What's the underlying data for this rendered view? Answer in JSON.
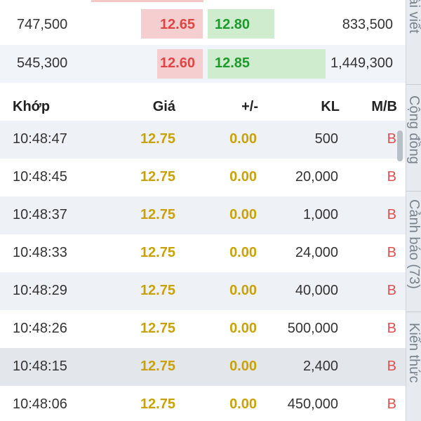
{
  "order_book": [
    {
      "bid_volume": "747,500",
      "bid_price": "12.65",
      "ask_price": "12.80",
      "ask_volume": "833,500"
    },
    {
      "bid_volume": "545,300",
      "bid_price": "12.60",
      "ask_price": "12.85",
      "ask_volume": "1,449,300"
    }
  ],
  "trades": {
    "headers": {
      "time": "Khớp",
      "price": "Giá",
      "change": "+/-",
      "volume": "KL",
      "side": "M/B"
    },
    "rows": [
      {
        "time": "10:48:47",
        "price": "12.75",
        "change": "0.00",
        "volume": "500",
        "side": "B"
      },
      {
        "time": "10:48:45",
        "price": "12.75",
        "change": "0.00",
        "volume": "20,000",
        "side": "B"
      },
      {
        "time": "10:48:37",
        "price": "12.75",
        "change": "0.00",
        "volume": "1,000",
        "side": "B"
      },
      {
        "time": "10:48:33",
        "price": "12.75",
        "change": "0.00",
        "volume": "24,000",
        "side": "B"
      },
      {
        "time": "10:48:29",
        "price": "12.75",
        "change": "0.00",
        "volume": "40,000",
        "side": "B"
      },
      {
        "time": "10:48:26",
        "price": "12.75",
        "change": "0.00",
        "volume": "500,000",
        "side": "B"
      },
      {
        "time": "10:48:15",
        "price": "12.75",
        "change": "0.00",
        "volume": "2,400",
        "side": "B"
      },
      {
        "time": "10:48:06",
        "price": "12.75",
        "change": "0.00",
        "volume": "450,000",
        "side": "B"
      }
    ]
  },
  "side_tabs": [
    {
      "label": "Bài viết"
    },
    {
      "label": "Cộng đồng"
    },
    {
      "label": "Cảnh báo (73)"
    },
    {
      "label": "Kiến thức"
    }
  ],
  "colors": {
    "bid_red": "#e04545",
    "ask_green": "#1c9a2c",
    "reference_yellow": "#c9a20a",
    "buy_marker": "#e05050"
  }
}
